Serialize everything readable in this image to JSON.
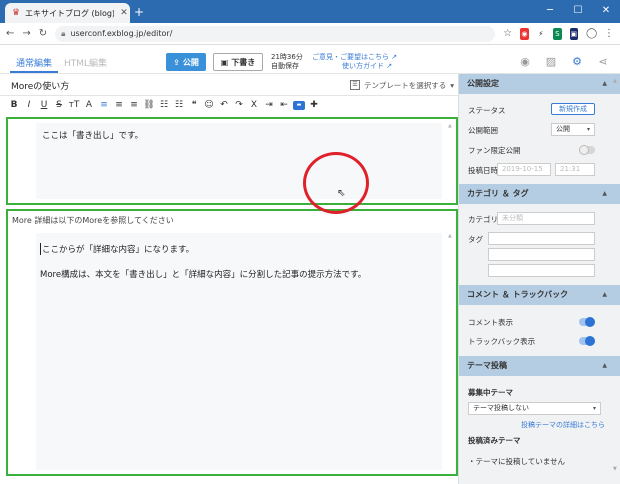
{
  "browser": {
    "tab_title": "エキサイトブログ (blog)",
    "url": "userconf.exblog.jp/editor/",
    "window_controls": [
      "minimize",
      "maximize",
      "close"
    ]
  },
  "app": {
    "tabs": [
      {
        "label": "通常編集",
        "active": true
      },
      {
        "label": "HTML編集",
        "active": false
      }
    ],
    "publish_label": "公開",
    "draft_label": "下書き",
    "autosave_time": "21時36分",
    "autosave_label": "自動保存",
    "feedback_link": "ご意見・ご要望はこちら",
    "guide_link": "使い方ガイド"
  },
  "editor": {
    "post_title": "Moreの使い方",
    "template_select": "テンプレートを選択する",
    "excerpt_text": "ここは「書き出し」です。",
    "more_line": "More 詳細は以下のMoreを参照してください",
    "detail_lines": [
      "ここからが「詳細な内容」になります。",
      "More構成は、本文を「書き出し」と「詳細な内容」に分割した記事の提示方法です。"
    ]
  },
  "panel": {
    "publish_settings": {
      "header": "公開設定",
      "status_label": "ステータス",
      "new_button": "新規作成",
      "scope_label": "公開範囲",
      "scope_value": "公開",
      "fan_label": "ファン限定公開",
      "date_label": "投稿日時",
      "date_value": "2019-10-15",
      "time_value": "21:31"
    },
    "category": {
      "header": "カテゴリ ＆ タグ",
      "category_label": "カテゴリ",
      "category_value": "未分類",
      "tag_label": "タグ"
    },
    "comments": {
      "header": "コメント ＆ トラックバック",
      "comment_label": "コメント表示",
      "trackback_label": "トラックバック表示"
    },
    "theme": {
      "header": "テーマ投稿",
      "recruiting_label": "募集中テーマ",
      "theme_select": "テーマ投稿しない",
      "theme_link": "投稿テーマの詳細はこちら",
      "posted_label": "投稿済みテーマ",
      "posted_value": "・テーマに投稿していません"
    }
  },
  "colors": {
    "accent": "#3a7bd5",
    "highlight_box": "#3bb03b",
    "annotation_circle": "#e0202a",
    "chrome": "#2d6bb0"
  }
}
